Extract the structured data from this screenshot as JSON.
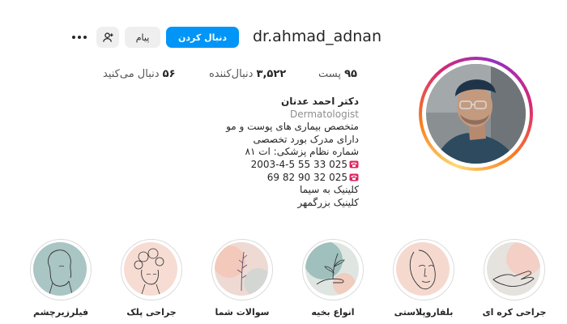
{
  "profile": {
    "username": "dr.ahmad_adnan",
    "follow_label": "دنبال کردن",
    "message_label": "پیام"
  },
  "stats": {
    "posts_value": "۹۵",
    "posts_label": "پست",
    "followers_value": "۳,۵۲۲",
    "followers_label": "دنبال‌کننده",
    "following_value": "۵۶",
    "following_label": "دنبال می‌کنید"
  },
  "bio": {
    "name": "دکتر احمد عدنان",
    "category": "Dermatologist",
    "line1": "متخصص بیماری های پوست و مو",
    "line2": "دارای مدرک بورد تخصصی",
    "line3": "شماره نظام پزشکی: ات ۸۱",
    "phone1": "2003-4-5 55 33 025",
    "phone2": "69 82 90 32 025",
    "clinic1": "کلینیک به سیما",
    "clinic2": "کلینیک بزرگمهر"
  },
  "highlights": [
    {
      "label": "جراحی کره ای",
      "icon": "hand-line-art-icon"
    },
    {
      "label": "بلفاروپلاستی",
      "icon": "face-line-art-icon"
    },
    {
      "label": "انواع بخیه",
      "icon": "hand-flower-line-art-icon"
    },
    {
      "label": "سوالات شما",
      "icon": "flower-line-art-icon"
    },
    {
      "label": "جراحی پلک",
      "icon": "flower-head-line-art-icon"
    },
    {
      "label": "فیلرزیرچشم",
      "icon": "woman-profile-line-art-icon"
    }
  ],
  "colors": {
    "follow_button": "#0095f6",
    "secondary_button": "#efefef",
    "highlight_pink": "#f4d4cb",
    "highlight_teal": "#9fc0c0"
  }
}
